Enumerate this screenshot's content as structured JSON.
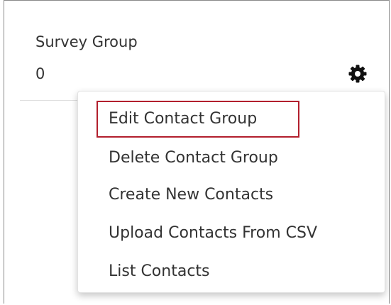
{
  "group": {
    "title": "Survey Group",
    "count": "0"
  },
  "icons": {
    "settings": "gear-icon"
  },
  "menu": {
    "items": [
      {
        "label": "Edit Contact Group",
        "highlighted": true
      },
      {
        "label": "Delete Contact Group",
        "highlighted": false
      },
      {
        "label": "Create New Contacts",
        "highlighted": false
      },
      {
        "label": "Upload Contacts From CSV",
        "highlighted": false
      },
      {
        "label": "List Contacts",
        "highlighted": false
      }
    ]
  },
  "colors": {
    "text": "#333333",
    "highlight_border": "#b21f2d",
    "menu_border": "#e2e2e2",
    "card_border": "#8a8a8a"
  }
}
